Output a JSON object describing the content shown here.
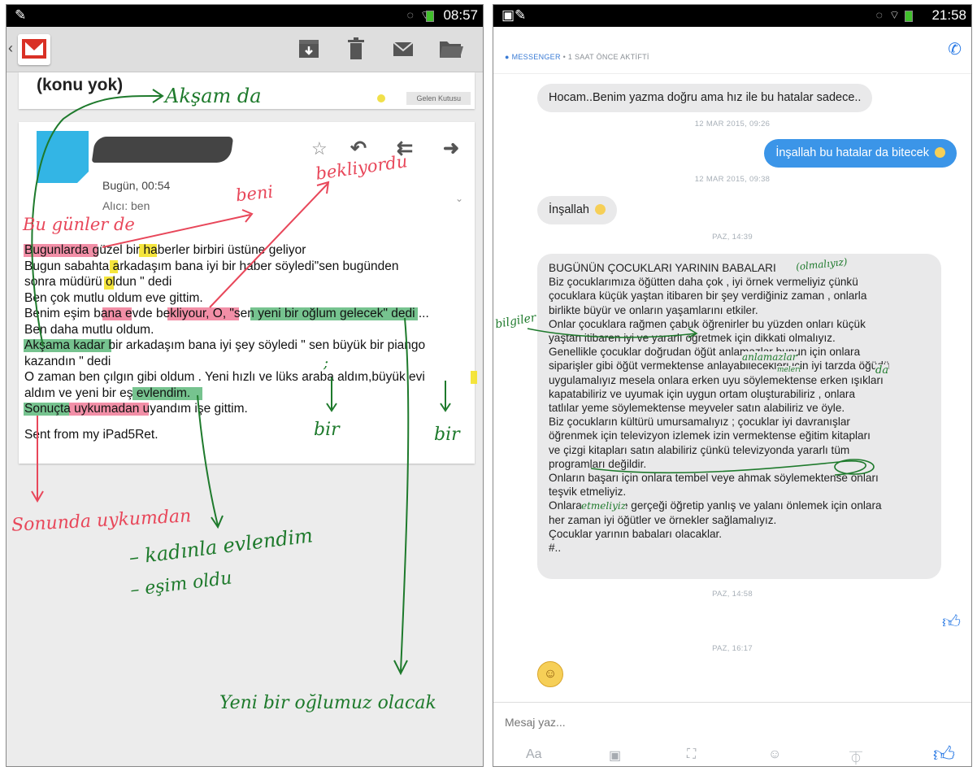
{
  "left": {
    "status": {
      "time": "08:57"
    },
    "subject": "(konu yok)",
    "label": "Gelen Kutusu",
    "message": {
      "date": "Bugün, 00:54",
      "to": "Alıcı: ben",
      "lines": [
        "Bugunlarda güzel bir haberler birbiri üstüne geliyor",
        "Bugun sabahta arkadaşım bana iyi bir haber söyledi\"sen bugünden",
        "sonra müdürü oldun \" dedi",
        "Ben çok mutlu oldum eve gittim.",
        "Benim eşim bana evde bekliyour, O, \"sen yeni bir oğlum gelecek\" dedi ...",
        "Ben daha mutlu oldum.",
        "Akşama kadar bir arkadaşım bana iyi şey söyledi \" sen büyük bir piango",
        "kazandın \" dedi",
        "O zaman ben çılgın gibi oldum . Yeni hızlı ve lüks araba aldım,büyük evi",
        "aldım ve yeni bir eş evlendim.",
        "Sonuçta uykumadan uyandım işe gittim."
      ],
      "signature": "Sent from my iPad5Ret."
    },
    "annotations": {
      "aksam": "Akşam da",
      "bekliyordu": "bekliyordu",
      "beni": "beni",
      "bu_gunlerde": "Bu günler de",
      "bir1": "bir",
      "bir2": "bir",
      "sonunda": "Sonunda uykumdan",
      "kadinla": "– kadınla evlendim",
      "esim": "– eşim oldu",
      "yeni_oglumuz": "Yeni bir oğlumuz olacak",
      "semicolon": ";"
    }
  },
  "right": {
    "status": {
      "time": "21:58"
    },
    "active": {
      "brand": "MESSENGER",
      "rest": " • 1 SAAT ÖNCE AKTİFTİ"
    },
    "messages": [
      {
        "text": "Hocam..Benim yazma doğru ama hız ile bu hatalar sadece.."
      },
      {
        "time": "12 MAR 2015, 09:26"
      },
      {
        "text": "İnşallah bu hatalar da bitecek"
      },
      {
        "time": "12 MAR 2015, 09:38"
      },
      {
        "text": "İnşallah"
      },
      {
        "time": "PAZ, 14:39"
      },
      {
        "time": "PAZ, 14:58"
      },
      {
        "time": "PAZ, 16:17"
      }
    ],
    "long_message": [
      "BUGÜNÜN ÇOCUKLARI YARININ BABALARI",
      "    Biz çocuklarımıza öğütten daha çok , iyi örnek vermeliyiz çünkü",
      "çocuklara küçük yaştan itibaren bir şey verdiğiniz zaman , onlarla",
      "birlikte büyür ve onların yaşamlarını etkiler.",
      "Onlar çocuklara rağmen çabuk öğrenirler bu yüzden onları küçük",
      "yaştan itibaren iyi ve yararlı öğretmek için dikkati olmalıyız.",
      "Genellikle çocuklar doğrudan öğüt anlamazlar bunun için onlara",
      "siparişler gibi öğüt vermektense anlayabilecekleri için iyi tarzda  öğüdü",
      "uygulamalıyız mesela onlara erken uyu söylemektense erken ışıkları",
      "kapatabiliriz ve uyumak için uygun ortam oluşturabiliriz , onlara",
      "tatlılar yeme söylemektense meyveler satın alabiliriz ve öyle.",
      "Biz çocukların kültürü umursamalıyız ; çocuklar iyi davranışlar",
      "öğrenmek için televizyon izlemek izin vermektense eğitim kitapları",
      "ve çizgi kitapları satın alabiliriz çünkü televizyonda yararlı tüm",
      "programları değildir.",
      "Onların başarı için onlara tembel veye ahmak söylemektense onları",
      "teşvik etmeliyiz.",
      "Onlara doğru ve gerçeği öğretip yanlış ve yalanı önlemek için onlara",
      "her zaman iyi öğütler ve örnekler sağlamalıyız.",
      "Çocuklar yarının babaları olacaklar.",
      "#.."
    ],
    "annotations": {
      "olmaliyiz": "(olmalıyız)",
      "bilgiler": "bilgiler",
      "anlamazlar": "anlamazlar",
      "meleri": "meleri",
      "da": "da",
      "etmeliyiz": "etmeliyiz"
    },
    "compose": {
      "placeholder": "Mesaj yaz...",
      "aa": "Aa"
    }
  },
  "colors": {
    "messenger_blue": "#3b95e8",
    "ink_red": "#e8475a",
    "ink_green": "#1e7a2c"
  }
}
